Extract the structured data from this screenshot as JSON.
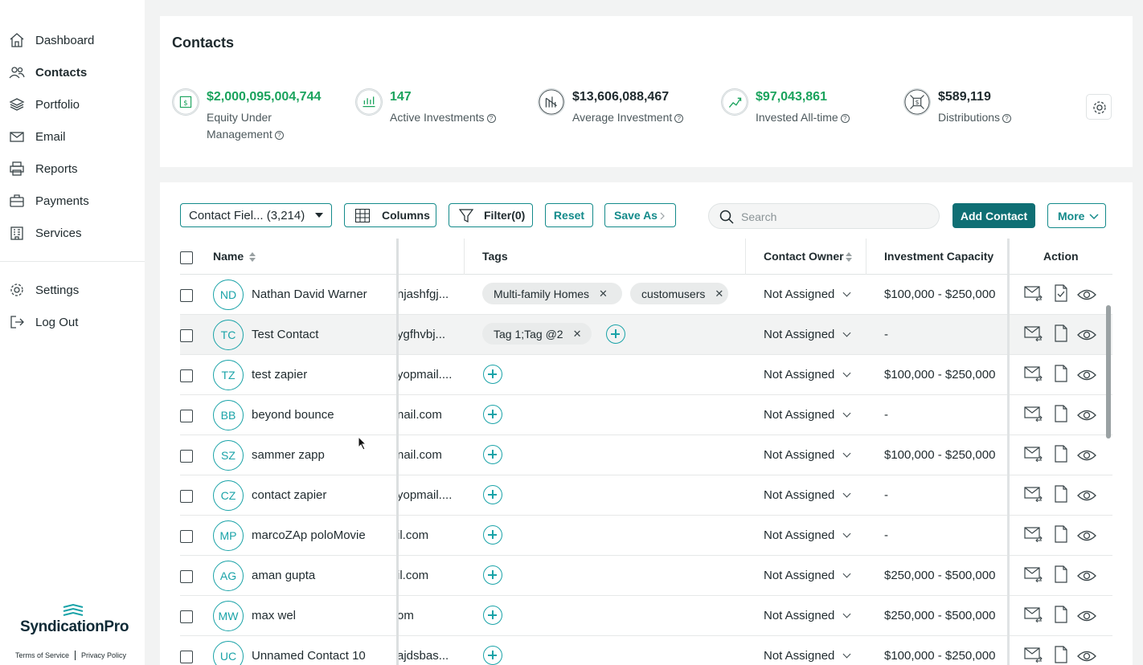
{
  "sidebar": {
    "items": [
      {
        "label": "Dashboard",
        "icon": "home-icon"
      },
      {
        "label": "Contacts",
        "icon": "users-icon",
        "active": true
      },
      {
        "label": "Portfolio",
        "icon": "layers-icon"
      },
      {
        "label": "Email",
        "icon": "mail-icon"
      },
      {
        "label": "Reports",
        "icon": "printer-icon"
      },
      {
        "label": "Payments",
        "icon": "briefcase-icon"
      },
      {
        "label": "Services",
        "icon": "building-icon"
      }
    ],
    "bottom_items": [
      {
        "label": "Settings",
        "icon": "gear-icon"
      },
      {
        "label": "Log Out",
        "icon": "logout-icon"
      }
    ],
    "logo_text": "SyndicationPro",
    "terms": "Terms of Service",
    "privacy": "Privacy Policy"
  },
  "page_title": "Contacts",
  "stats": [
    {
      "value": "$2,000,095,004,744",
      "label1": "Equity Under",
      "label2": "Management",
      "icon": "equity-icon",
      "green": true
    },
    {
      "value": "147",
      "label1": "Active Investments",
      "icon": "active-investments-icon",
      "green": true
    },
    {
      "value": "$13,606,088,467",
      "label1": "Average Investment",
      "icon": "average-investment-icon",
      "green": false
    },
    {
      "value": "$97,043,861",
      "label1": "Invested All-time",
      "icon": "invested-icon",
      "green": true
    },
    {
      "value": "$589,119",
      "label1": "Distributions",
      "icon": "distributions-icon",
      "green": false
    }
  ],
  "toolbar": {
    "contact_fields": "Contact Fiel... (3,214)",
    "columns": "Columns",
    "filter": "Filter(0)",
    "reset": "Reset",
    "save_as": "Save As",
    "search_placeholder": "Search",
    "add_contact": "Add Contact",
    "more": "More"
  },
  "table": {
    "headers": {
      "name": "Name",
      "tags": "Tags",
      "owner": "Contact Owner",
      "capacity": "Investment Capacity",
      "action": "Action"
    },
    "rows": [
      {
        "initials": "ND",
        "name": "Nathan David Warner",
        "email": "njashfgj...",
        "tags": [
          "Multi-family Homes",
          "customusers"
        ],
        "owner": "Not Assigned",
        "capacity": "$100,000 - $250,000"
      },
      {
        "initials": "TC",
        "name": "Test Contact",
        "email": "ygfhvbj...",
        "tags": [
          "Tag 1;Tag @2"
        ],
        "owner": "Not Assigned",
        "capacity": "-"
      },
      {
        "initials": "TZ",
        "name": "test zapier",
        "email": "yopmail....",
        "tags": [],
        "owner": "Not Assigned",
        "capacity": "$100,000 - $250,000"
      },
      {
        "initials": "BB",
        "name": "beyond bounce",
        "email": "nail.com",
        "tags": [],
        "owner": "Not Assigned",
        "capacity": "-"
      },
      {
        "initials": "SZ",
        "name": "sammer zapp",
        "email": "nail.com",
        "tags": [],
        "owner": "Not Assigned",
        "capacity": "$100,000 - $250,000"
      },
      {
        "initials": "CZ",
        "name": "contact zapier",
        "email": "yopmail....",
        "tags": [],
        "owner": "Not Assigned",
        "capacity": "-"
      },
      {
        "initials": "MP",
        "name": "marcoZAp poloMovie",
        "email": "il.com",
        "tags": [],
        "owner": "Not Assigned",
        "capacity": "-"
      },
      {
        "initials": "AG",
        "name": "aman gupta",
        "email": "il.com",
        "tags": [],
        "owner": "Not Assigned",
        "capacity": "$250,000 - $500,000"
      },
      {
        "initials": "MW",
        "name": "max wel",
        "email": "om",
        "tags": [],
        "owner": "Not Assigned",
        "capacity": "$250,000 - $500,000"
      },
      {
        "initials": "UC",
        "name": "Unnamed Contact 10",
        "email": "ajdsbas...",
        "tags": [],
        "owner": "Not Assigned",
        "capacity": "$100,000 - $250,000"
      }
    ]
  },
  "colors": {
    "accent": "#0f6f74",
    "teal": "#1aa3a8",
    "green": "#1aa35d"
  }
}
